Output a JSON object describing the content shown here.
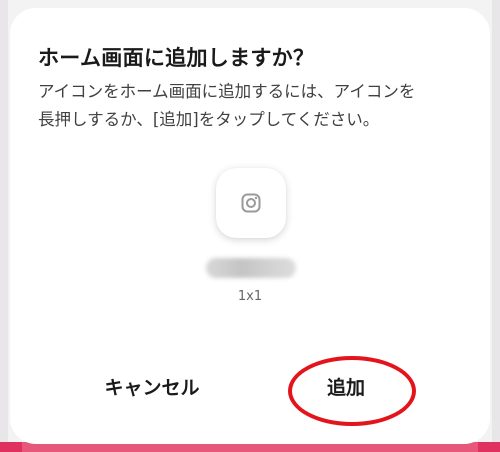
{
  "dialog": {
    "title": "ホーム画面に追加しますか？",
    "message_line1": "アイコンをホーム画面に追加するには、アイコンを",
    "message_line2": "長押しするか、[追加]をタップしてください。",
    "widget": {
      "icon": "instagram-icon",
      "size": "1x1"
    },
    "buttons": {
      "cancel_label": "キャンセル",
      "add_label": "追加"
    }
  },
  "colors": {
    "highlight": "#e3141c",
    "background_edge": "#e6577a",
    "icon_gray": "#9a9a9a"
  }
}
